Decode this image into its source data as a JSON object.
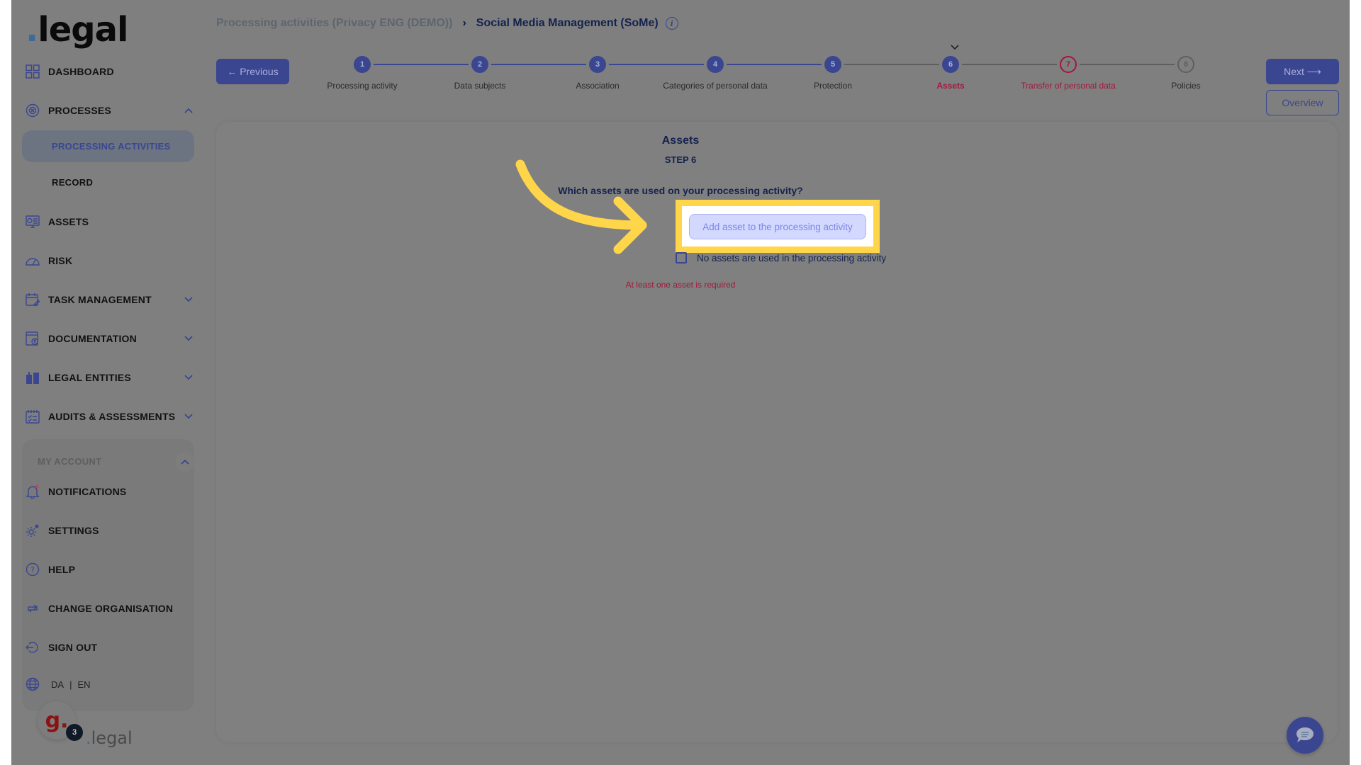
{
  "brand": {
    "logo_dot": ".",
    "logo_text": "legal",
    "small_logo_dot": ".",
    "small_logo_text": "legal",
    "org_avatar_letter": "g.",
    "org_badge_count": "3"
  },
  "sidebar": {
    "items": [
      {
        "label": "DASHBOARD",
        "icon": "dashboard-grid-icon"
      },
      {
        "label": "PROCESSES",
        "icon": "processes-icon",
        "expanded": true
      },
      {
        "label": "ASSETS",
        "icon": "assets-icon"
      },
      {
        "label": "RISK",
        "icon": "risk-gauge-icon"
      },
      {
        "label": "TASK MANAGEMENT",
        "icon": "task-calendar-icon",
        "expandable": true
      },
      {
        "label": "DOCUMENTATION",
        "icon": "documentation-icon",
        "expandable": true
      },
      {
        "label": "LEGAL ENTITIES",
        "icon": "legal-entities-icon",
        "expandable": true
      },
      {
        "label": "AUDITS & ASSESSMENTS",
        "icon": "audits-icon",
        "expandable": true
      }
    ],
    "sub_items": [
      {
        "label": "PROCESSING ACTIVITIES",
        "active": true
      },
      {
        "label": "RECORD",
        "active": false
      }
    ],
    "account": {
      "title": "MY ACCOUNT",
      "items": [
        {
          "label": "NOTIFICATIONS",
          "icon": "bell-icon"
        },
        {
          "label": "SETTINGS",
          "icon": "gear-icon"
        },
        {
          "label": "HELP",
          "icon": "help-icon"
        },
        {
          "label": "CHANGE ORGANISATION",
          "icon": "swap-icon"
        },
        {
          "label": "SIGN OUT",
          "icon": "sign-out-icon"
        }
      ],
      "languages": [
        "DA",
        "EN"
      ],
      "lang_separator": "|"
    }
  },
  "header": {
    "breadcrumb_parent": "Processing activities (Privacy ENG (DEMO))",
    "breadcrumb_separator": "›",
    "breadcrumb_current": "Social Media Management (SoMe)",
    "info_glyph": "i",
    "previous_label": "← Previous",
    "next_label": "Next ⟶",
    "overview_label": "Overview"
  },
  "stepper": {
    "current_step": 6,
    "steps": [
      {
        "number": "1",
        "label": "Processing activity",
        "state": "done"
      },
      {
        "number": "2",
        "label": "Data subjects",
        "state": "done"
      },
      {
        "number": "3",
        "label": "Association",
        "state": "done"
      },
      {
        "number": "4",
        "label": "Categories of personal data",
        "state": "done"
      },
      {
        "number": "5",
        "label": "Protection",
        "state": "done"
      },
      {
        "number": "6",
        "label": "Assets",
        "state": "current"
      },
      {
        "number": "7",
        "label": "Transfer of personal data",
        "state": "error"
      },
      {
        "number": "8",
        "label": "Policies",
        "state": "todo"
      }
    ]
  },
  "content": {
    "title": "Assets",
    "step_label": "STEP 6",
    "question": "Which assets are used on your processing activity?",
    "add_button_label": "Add asset to the processing activity",
    "checkbox_label": "No assets are used in the processing activity",
    "checkbox_checked": false,
    "error_message": "At least one asset is required"
  },
  "colors": {
    "primary": "#3a4690",
    "error": "#a3173e",
    "highlight": "#ffd54a",
    "text_dark": "#14224e"
  }
}
